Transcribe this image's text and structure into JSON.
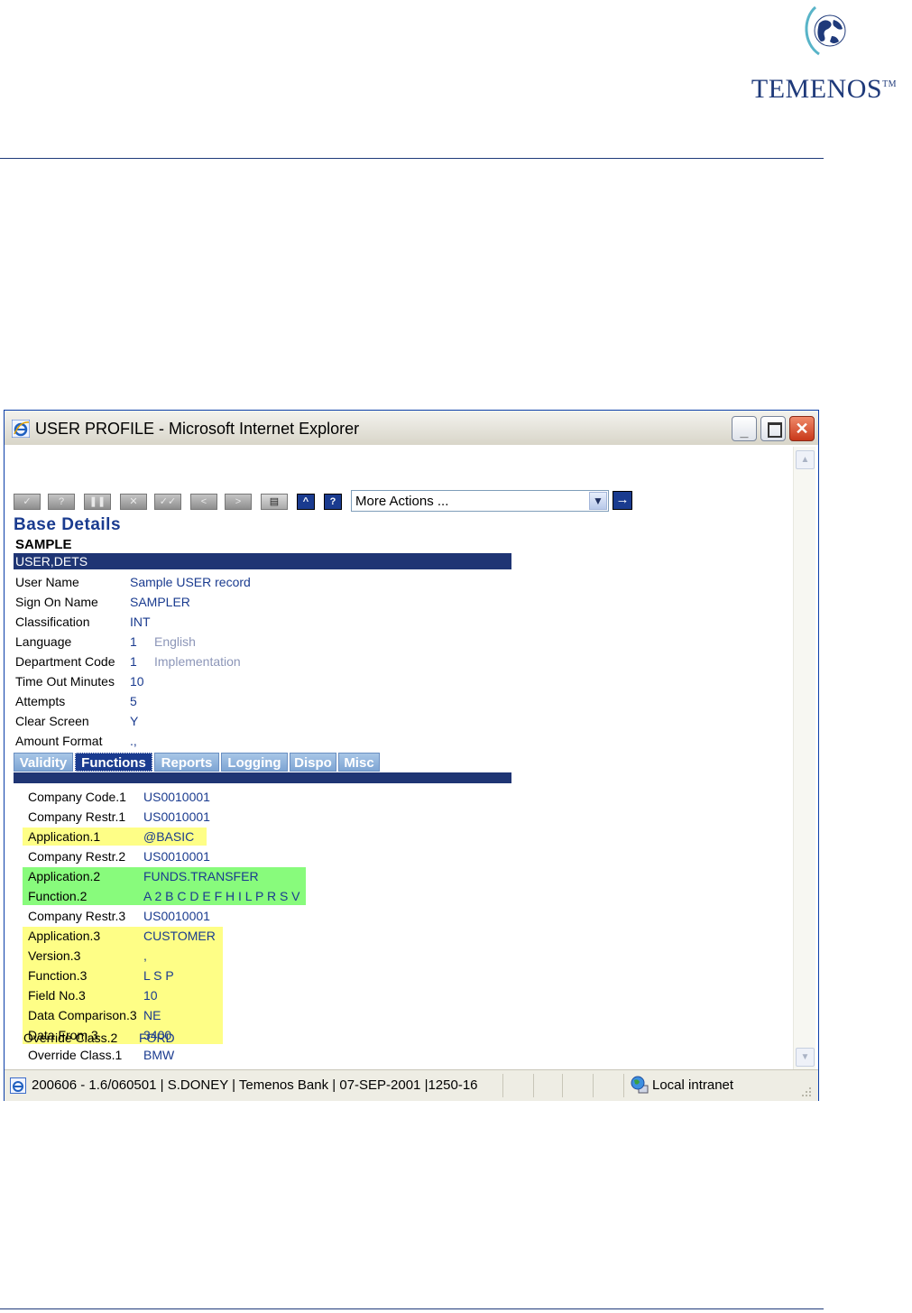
{
  "logo": {
    "text": "TEMENOS",
    "tm": "TM"
  },
  "window": {
    "title": "USER PROFILE - Microsoft Internet Explorer",
    "controls": {
      "minimize": "_",
      "close": "✕"
    }
  },
  "toolbar": {
    "buttons": [
      "✓",
      "?",
      "❚❚",
      "✕",
      "✓✓",
      "<",
      ">",
      "▤",
      "^",
      "?"
    ],
    "more_actions": "More Actions ...",
    "go": "→"
  },
  "page": {
    "section_title": "Base Details",
    "record_id": "SAMPLE",
    "header_bar": "USER,DETS"
  },
  "fields": [
    {
      "label": "User Name",
      "value": "Sample USER record",
      "enrichment": ""
    },
    {
      "label": "Sign On Name",
      "value": "SAMPLER",
      "enrichment": ""
    },
    {
      "label": "Classification",
      "value": "INT",
      "enrichment": ""
    },
    {
      "label": "Language",
      "value": "1",
      "enrichment": "English"
    },
    {
      "label": "Department Code",
      "value": "1",
      "enrichment": "Implementation"
    },
    {
      "label": "Time Out Minutes",
      "value": "10",
      "enrichment": ""
    },
    {
      "label": "Attempts",
      "value": "5",
      "enrichment": ""
    },
    {
      "label": "Clear Screen",
      "value": "Y",
      "enrichment": ""
    },
    {
      "label": "Amount Format",
      "value": ".,",
      "enrichment": ""
    }
  ],
  "tabs": [
    "Validity",
    "Functions",
    "Reports",
    "Logging",
    "Dispo",
    "Misc"
  ],
  "active_tab": "Functions",
  "functions": [
    {
      "label": "Company Code.1",
      "value": "US0010001",
      "highlight": "none"
    },
    {
      "label": "Company Restr.1",
      "value": "US0010001",
      "highlight": "none"
    },
    {
      "label": "Application.1",
      "value": "@BASIC",
      "highlight": "yellow"
    },
    {
      "label": "Company Restr.2",
      "value": "US0010001",
      "highlight": "none"
    },
    {
      "label": "Application.2",
      "value": "FUNDS.TRANSFER",
      "highlight": "green"
    },
    {
      "label": "Function.2",
      "value": "A 2 B C D E F H I L P R S V",
      "highlight": "green"
    },
    {
      "label": "Company Restr.3",
      "value": "US0010001",
      "highlight": "none"
    },
    {
      "label": "Application.3",
      "value": "CUSTOMER",
      "highlight": "yellow"
    },
    {
      "label": "Version.3",
      "value": ",",
      "highlight": "yellow"
    },
    {
      "label": "Function.3",
      "value": "L S P",
      "highlight": "yellow"
    },
    {
      "label": "Field No.3",
      "value": "10",
      "highlight": "yellow"
    },
    {
      "label": "Data Comparison.3",
      "value": "NE",
      "highlight": "yellow"
    },
    {
      "label": "Data From.3",
      "value": "3400",
      "highlight": "yellow"
    },
    {
      "label": "Override Class.1",
      "value": "BMW",
      "highlight": "none"
    },
    {
      "label": "Override Class.2",
      "value": "FORD",
      "highlight": "none"
    }
  ],
  "status_bar": {
    "text": "200606 - 1.6/060501 | S.DONEY | Temenos Bank | 07-SEP-2001 |1250-16",
    "zone": "Local intranet"
  },
  "colors": {
    "brand": "#1f3a7a",
    "header_bar": "#1f3574",
    "value_text": "#1a3b8f",
    "highlight_yellow": "#fefe86",
    "highlight_green": "#88fb7c"
  }
}
